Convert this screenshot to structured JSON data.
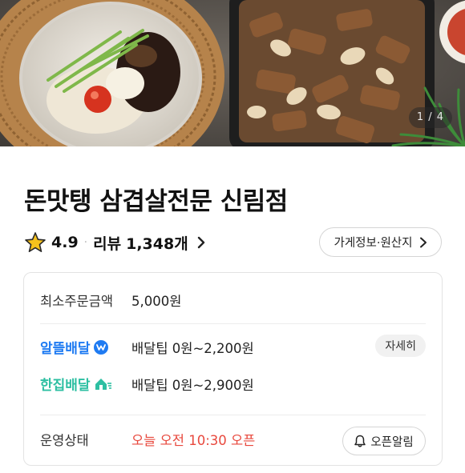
{
  "hero": {
    "page_counter": "1 / 4"
  },
  "store": {
    "name": "돈맛탱 삼겹살전문 신림점"
  },
  "rating": {
    "score": "4.9",
    "separator": "·",
    "review_label": "리뷰",
    "review_count": "1,348개"
  },
  "info_button": {
    "label": "가게정보·원산지"
  },
  "order_info": {
    "min_order_label": "최소주문금액",
    "min_order_value": "5,000원",
    "delivery_options": [
      {
        "brand": "알뜰배달",
        "fee": "배달팁 0원~2,200원",
        "color": "#1f7bf2"
      },
      {
        "brand": "한집배달",
        "fee": "배달팁 0원~2,900원",
        "color": "#2dbfa2"
      }
    ],
    "detail_button": "자세히",
    "status_label": "운영상태",
    "status_value": "오늘 오전 10:30 오픈",
    "status_color": "#e8483d",
    "alarm_button": "오픈알림"
  }
}
